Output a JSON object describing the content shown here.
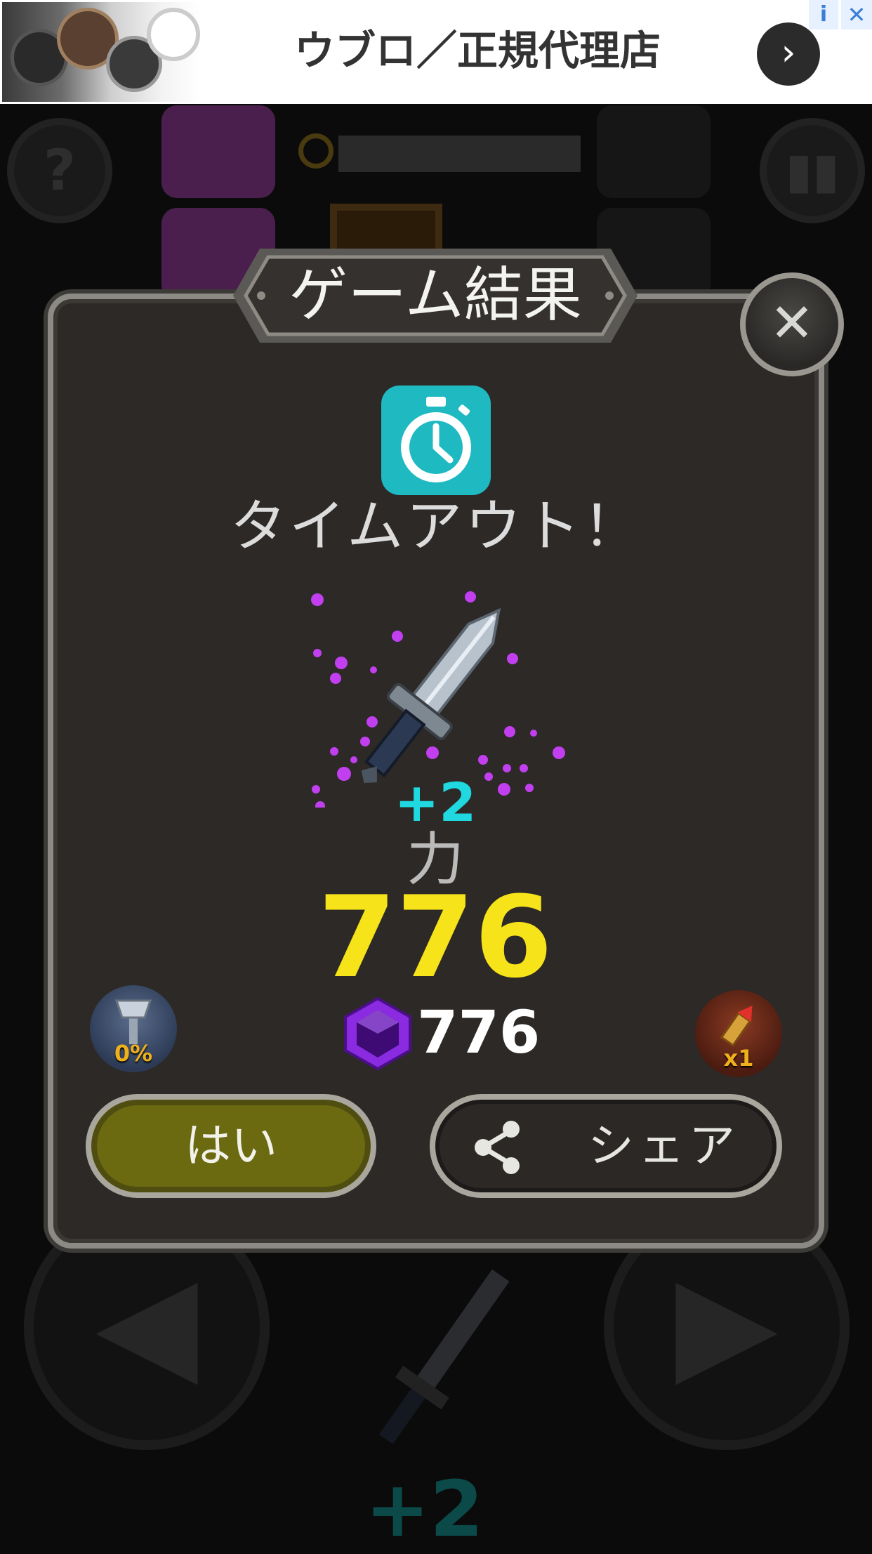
{
  "ad": {
    "title": "ウブロ／正規代理店",
    "arrow_icon": "chevron-right-icon",
    "info_icon": "info-icon",
    "close_icon": "close-icon"
  },
  "dialog": {
    "title": "ゲーム結果",
    "close_icon": "x-icon",
    "status_icon": "stopwatch-icon",
    "status_text": "タイムアウト！",
    "reward_item": "sword-icon",
    "level_gain": "+2",
    "stat_label": "力",
    "stat_value": "776",
    "gem_icon": "purple-gem-icon",
    "gem_count": "776",
    "left_bonus": {
      "icon": "hammer-icon",
      "text": "0%"
    },
    "right_bonus": {
      "icon": "rocket-icon",
      "text": "x1"
    },
    "yes_button": "はい",
    "share_button": "シェア",
    "share_icon": "share-icon"
  },
  "background": {
    "help_label": "?",
    "pause_icon": "pause-icon",
    "level_gain": "+2"
  },
  "colors": {
    "dialog_bg": "#2c2927",
    "stat_value": "#f7e31a",
    "level_gain": "#1fd8e0",
    "timeout_icon_bg": "#1fb9c2",
    "yes_button": "#6b6a10"
  }
}
